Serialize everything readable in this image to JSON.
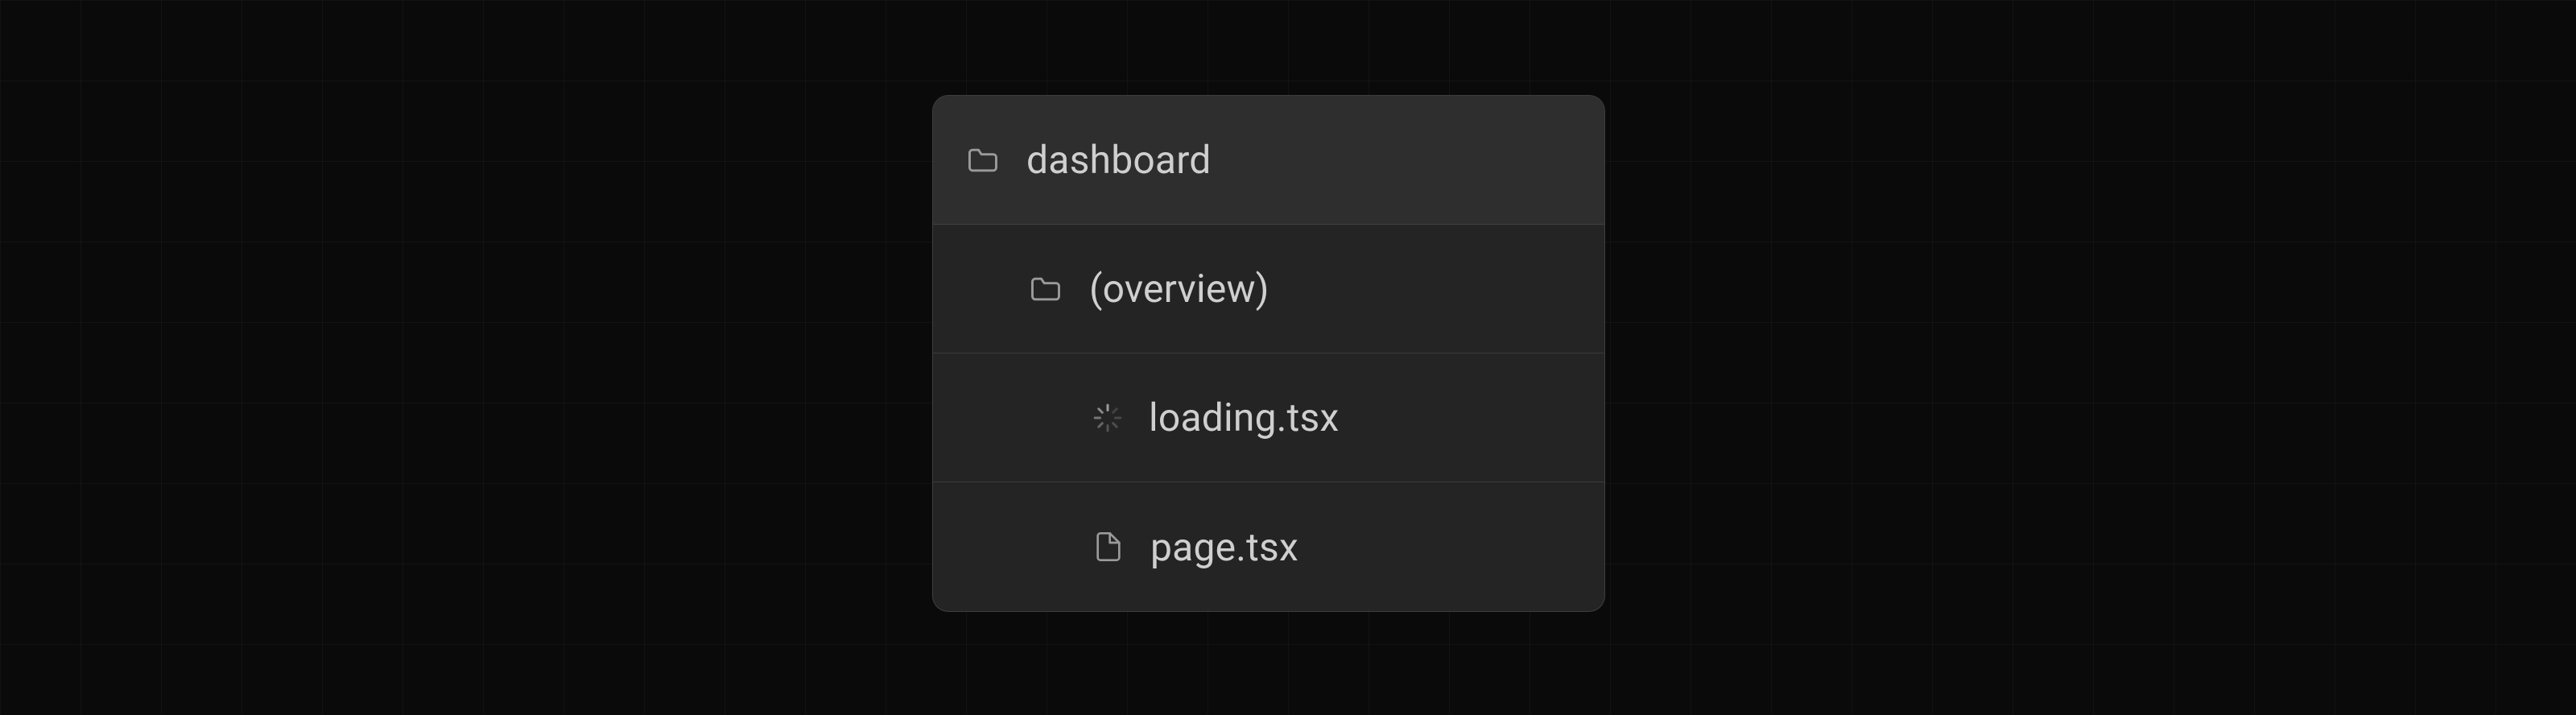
{
  "fileTree": {
    "items": [
      {
        "label": "dashboard",
        "icon": "folder",
        "depth": 0
      },
      {
        "label": "(overview)",
        "icon": "folder",
        "depth": 1
      },
      {
        "label": "loading.tsx",
        "icon": "spinner",
        "depth": 2
      },
      {
        "label": "page.tsx",
        "icon": "file",
        "depth": 2
      }
    ]
  }
}
